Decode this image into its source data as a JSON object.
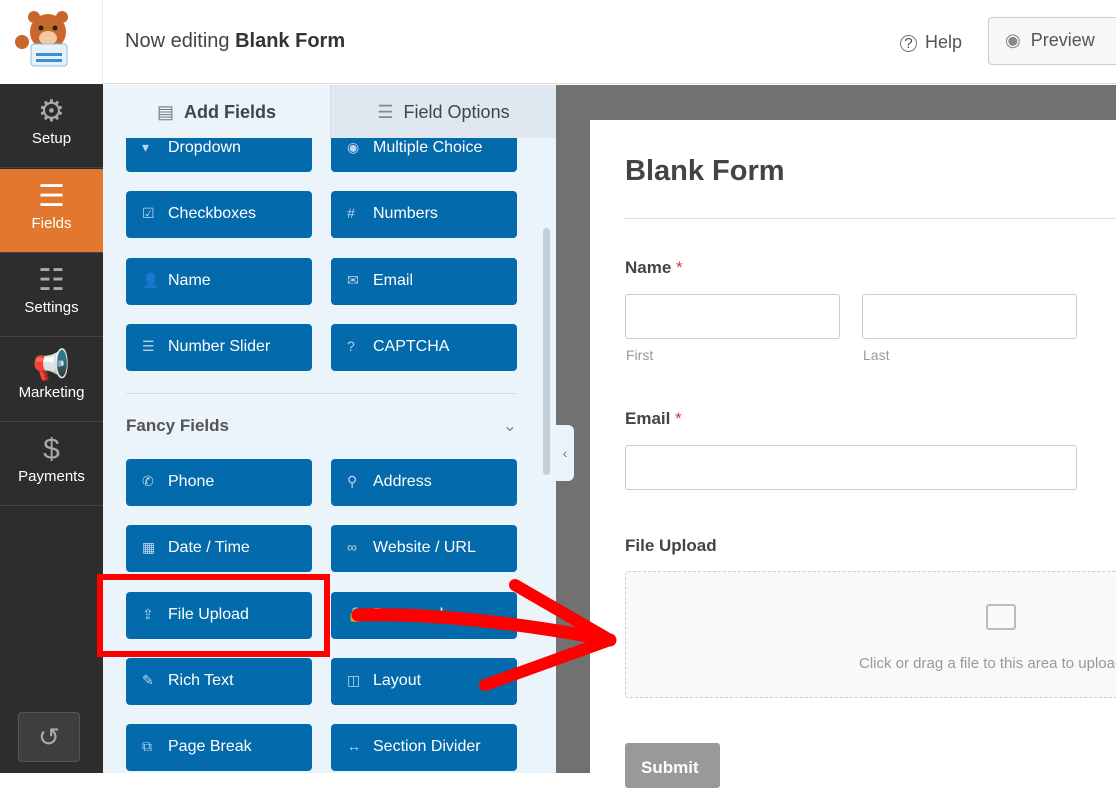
{
  "header": {
    "prefix": "Now editing",
    "form_name": "Blank Form",
    "help": "Help",
    "preview": "Preview"
  },
  "sidebar": {
    "items": [
      {
        "label": "Setup",
        "icon": "gear-icon",
        "glyph": "⚙"
      },
      {
        "label": "Fields",
        "icon": "fields-icon",
        "glyph": "☰",
        "active": true
      },
      {
        "label": "Settings",
        "icon": "sliders-icon",
        "glyph": "☷"
      },
      {
        "label": "Marketing",
        "icon": "megaphone-icon",
        "glyph": "📢"
      },
      {
        "label": "Payments",
        "icon": "dollar-icon",
        "glyph": "$"
      }
    ],
    "history_icon": "↺"
  },
  "panel": {
    "tabs": [
      {
        "label": "Add Fields",
        "glyph": "▤"
      },
      {
        "label": "Field Options",
        "glyph": "☰"
      }
    ],
    "standard_fields": [
      {
        "label": "Dropdown",
        "glyph": "▾"
      },
      {
        "label": "Multiple Choice",
        "glyph": "◉"
      },
      {
        "label": "Checkboxes",
        "glyph": "☑"
      },
      {
        "label": "Numbers",
        "glyph": "#"
      },
      {
        "label": "Name",
        "glyph": "👤"
      },
      {
        "label": "Email",
        "glyph": "✉"
      },
      {
        "label": "Number Slider",
        "glyph": "☰"
      },
      {
        "label": "CAPTCHA",
        "glyph": "?"
      }
    ],
    "fancy_title": "Fancy Fields",
    "fancy_fields": [
      {
        "label": "Phone",
        "glyph": "✆"
      },
      {
        "label": "Address",
        "glyph": "⚲"
      },
      {
        "label": "Date / Time",
        "glyph": "▦"
      },
      {
        "label": "Website / URL",
        "glyph": "∞"
      },
      {
        "label": "File Upload",
        "glyph": "⇪"
      },
      {
        "label": "Password",
        "glyph": "🔒"
      },
      {
        "label": "Rich Text",
        "glyph": "✎"
      },
      {
        "label": "Layout",
        "glyph": "◫"
      },
      {
        "label": "Page Break",
        "glyph": "⧉"
      },
      {
        "label": "Section Divider",
        "glyph": "↔"
      }
    ]
  },
  "form": {
    "title": "Blank Form",
    "name_label": "Name",
    "first": "First",
    "last": "Last",
    "email_label": "Email",
    "required": "*",
    "upload_label": "File Upload",
    "upload_hint": "Click or drag a file to this area to upload.",
    "submit": "Submit"
  },
  "colors": {
    "accent": "#e27730",
    "button": "#036aab",
    "highlight": "#ff0000"
  }
}
